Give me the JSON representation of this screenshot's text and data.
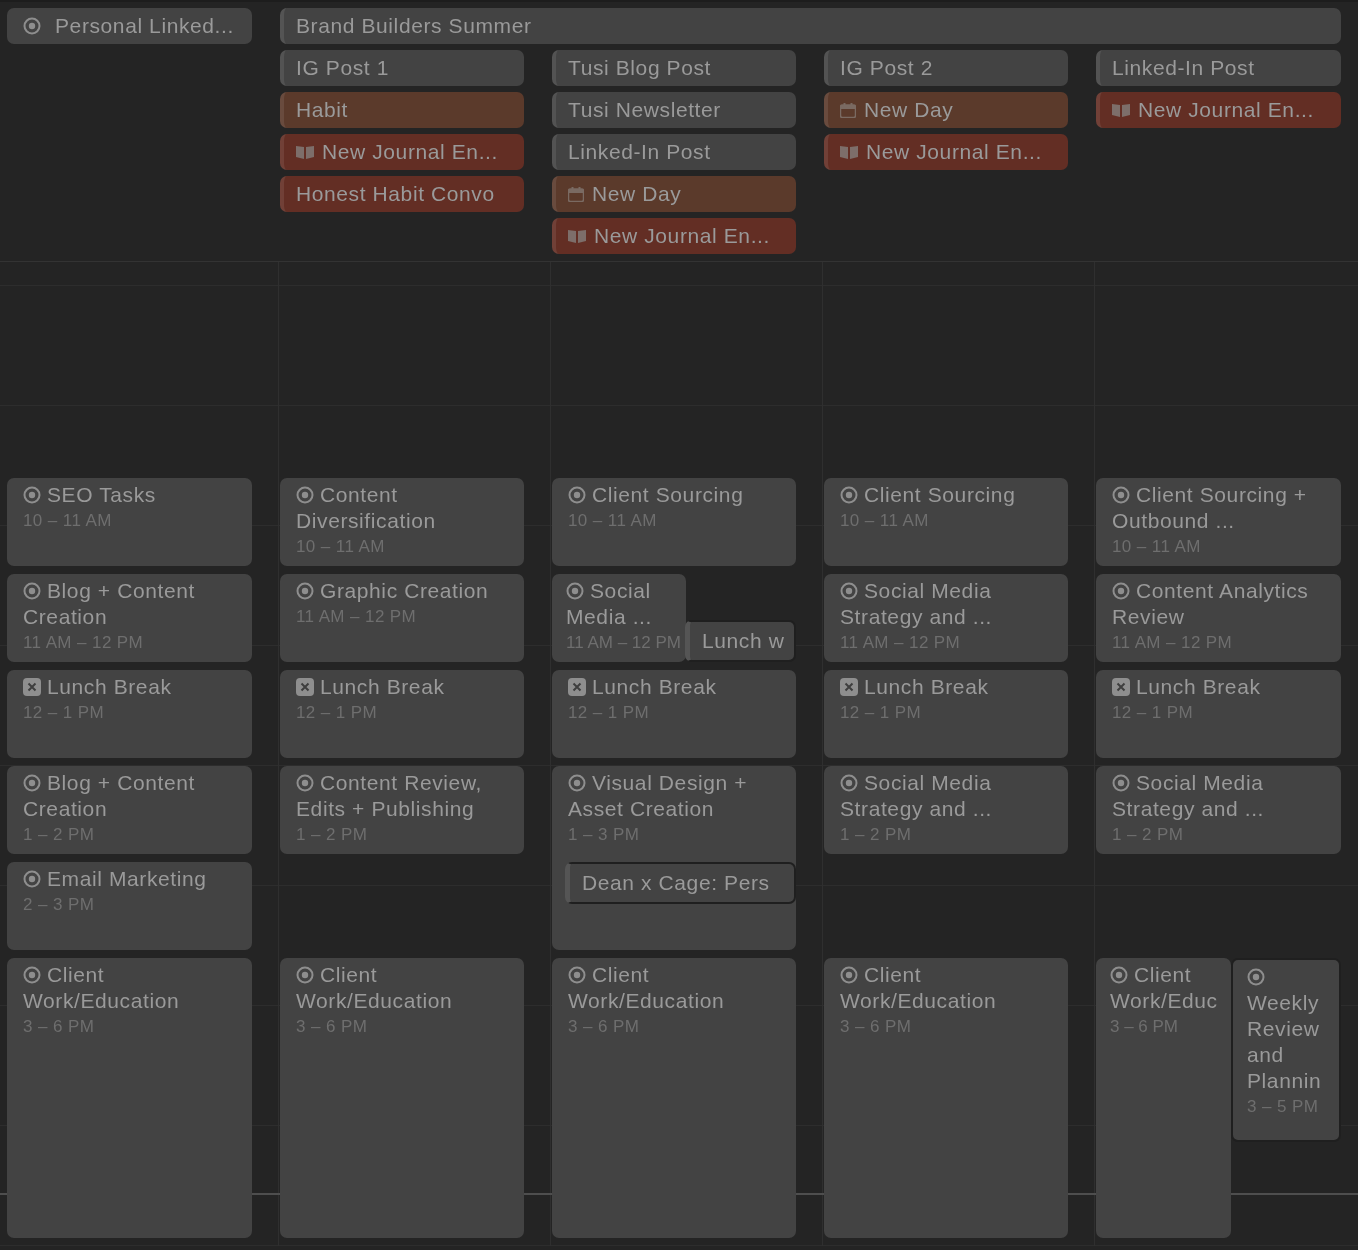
{
  "all_day_top_row": [
    {
      "title": "Personal Linked...",
      "kind": "goal"
    },
    {
      "title": "Brand Builders Summer",
      "kind": "banner"
    }
  ],
  "days": [
    {
      "events": [
        {
          "title": "SEO Tasks",
          "time": "10 – 11 AM",
          "kind": "task"
        },
        {
          "title": "Blog + Content Creation",
          "time": "11 AM – 12 PM",
          "kind": "task"
        },
        {
          "title": "Lunch Break",
          "time": "12 – 1 PM",
          "kind": "break"
        },
        {
          "title": "Blog + Content Creation",
          "time": "1 – 2 PM",
          "kind": "task"
        },
        {
          "title": "Email Marketing",
          "time": "2 – 3 PM",
          "kind": "task"
        },
        {
          "title": "Client Work/Education",
          "time": "3 – 6 PM",
          "kind": "task"
        }
      ]
    },
    {
      "all_day": [
        {
          "title": "IG Post 1",
          "color": "#434343",
          "kind": "plain"
        },
        {
          "title": "Habit",
          "color": "#5b3a2b",
          "kind": "plain"
        },
        {
          "title": "New Journal En...",
          "color": "#632e24",
          "kind": "journal"
        },
        {
          "title": "Honest Habit Convo",
          "color": "#632e24",
          "kind": "plain"
        }
      ],
      "events": [
        {
          "title": "Content Diversification",
          "time": "10 – 11 AM",
          "kind": "task"
        },
        {
          "title": "Graphic Creation",
          "time": "11 AM – 12 PM",
          "kind": "task"
        },
        {
          "title": "Lunch Break",
          "time": "12 – 1 PM",
          "kind": "break"
        },
        {
          "title": "Content Review, Edits + Publishing",
          "time": "1 – 2 PM",
          "kind": "task"
        },
        {
          "title": "Client Work/Education",
          "time": "3 – 6 PM",
          "kind": "task"
        }
      ]
    },
    {
      "all_day": [
        {
          "title": "Tusi Blog Post",
          "color": "#434343",
          "kind": "plain"
        },
        {
          "title": "Tusi Newsletter",
          "color": "#434343",
          "kind": "plain"
        },
        {
          "title": "Linked-In Post",
          "color": "#434343",
          "kind": "plain"
        },
        {
          "title": "New Day",
          "color": "#5b3a2b",
          "kind": "day"
        },
        {
          "title": "New Journal En...",
          "color": "#632e24",
          "kind": "journal"
        }
      ],
      "events": [
        {
          "title": "Client Sourcing",
          "time": "10 – 11 AM",
          "kind": "task"
        },
        {
          "title": "Social Media ...",
          "time": "11 AM – 12 PM",
          "kind": "task",
          "overlap": {
            "title": "Lunch w",
            "kind": "side"
          }
        },
        {
          "title": "Lunch Break",
          "time": "12 – 1 PM",
          "kind": "break"
        },
        {
          "title": "Visual Design + Asset Creation",
          "time": "1 – 3 PM",
          "kind": "task",
          "overlap": {
            "title": "Dean x Cage: Pers",
            "kind": "below"
          }
        },
        {
          "title": "Client Work/Education",
          "time": "3 – 6 PM",
          "kind": "task"
        }
      ]
    },
    {
      "all_day": [
        {
          "title": "IG Post 2",
          "color": "#434343",
          "kind": "plain"
        },
        {
          "title": "New Day",
          "color": "#5b3a2b",
          "kind": "day"
        },
        {
          "title": "New Journal En...",
          "color": "#632e24",
          "kind": "journal"
        }
      ],
      "events": [
        {
          "title": "Client Sourcing",
          "time": "10 – 11 AM",
          "kind": "task"
        },
        {
          "title": "Social Media Strategy and ...",
          "time": "11 AM – 12 PM",
          "kind": "task"
        },
        {
          "title": "Lunch Break",
          "time": "12 – 1 PM",
          "kind": "break"
        },
        {
          "title": "Social Media Strategy and ...",
          "time": "1 – 2 PM",
          "kind": "task"
        },
        {
          "title": "Client Work/Education",
          "time": "3 – 6 PM",
          "kind": "task"
        }
      ]
    },
    {
      "all_day": [
        {
          "title": "Linked-In Post",
          "color": "#434343",
          "kind": "plain"
        },
        {
          "title": "New Journal En...",
          "color": "#632e24",
          "kind": "journal"
        }
      ],
      "events": [
        {
          "title": "Client Sourcing + Outbound ...",
          "time": "10 – 11 AM",
          "kind": "task"
        },
        {
          "title": "Content Analytics Review",
          "time": "11 AM – 12 PM",
          "kind": "task"
        },
        {
          "title": "Lunch Break",
          "time": "12 – 1 PM",
          "kind": "break"
        },
        {
          "title": "Social Media Strategy and ...",
          "time": "1 – 2 PM",
          "kind": "task"
        },
        {
          "title": "Client Work/Educ",
          "time": "3 – 6 PM",
          "kind": "task"
        },
        {
          "title": "Weekly Review and Plannin",
          "time": "3 – 5 PM",
          "kind": "task"
        }
      ]
    }
  ]
}
